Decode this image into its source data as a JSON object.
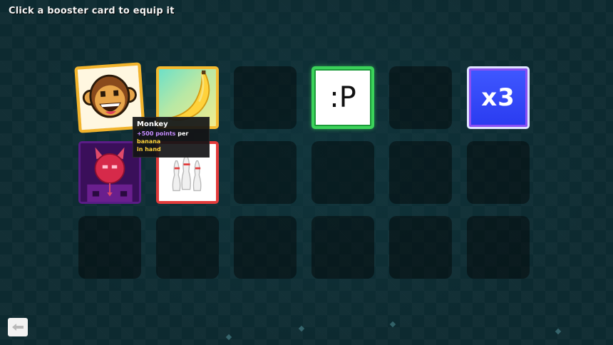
{
  "header": {
    "instruction": "Click a booster card to equip it"
  },
  "grid": {
    "columns": 6,
    "rows": 3
  },
  "cards": [
    {
      "slot": 0,
      "name": "Monkey",
      "icon": "monkey-face-icon"
    },
    {
      "slot": 1,
      "icon": "banana-icon"
    },
    {
      "slot": 3,
      "label": ":P",
      "icon": "tongue-face-text"
    },
    {
      "slot": 5,
      "label": "x3",
      "icon": "multiplier-icon"
    },
    {
      "slot": 6,
      "icon": "devil-icon"
    },
    {
      "slot": 7,
      "icon": "bowling-pins-icon"
    }
  ],
  "tooltip": {
    "title": "Monkey",
    "points": "+500 points",
    "per": " per ",
    "banana": "banana",
    "in_hand": "in hand"
  },
  "footer": {
    "back_icon": "arrow-left-icon"
  },
  "colors": {
    "background": "#0d2a30",
    "points_text": "#c58cff",
    "banana_text": "#ffd23b",
    "monkey_border": "#f2b42c",
    "tongue_border": "#3bd25a",
    "x3_fill": "#2a3bf0",
    "bowling_border": "#e23b3b"
  }
}
